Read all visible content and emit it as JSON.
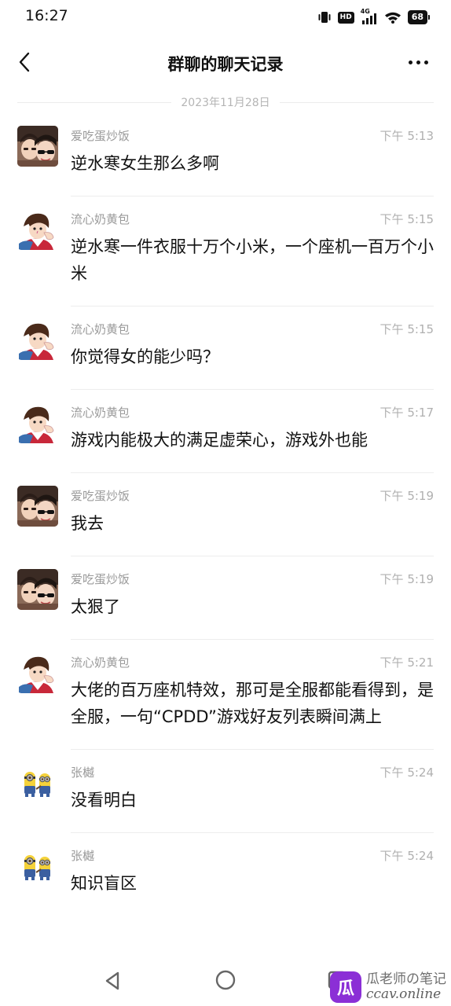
{
  "status_bar": {
    "time": "16:27",
    "hd_label": "HD",
    "network_label": "4G",
    "battery_level": "68"
  },
  "header": {
    "title": "群聊的聊天记录"
  },
  "date_divider": "2023年11月28日",
  "messages": [
    {
      "sender": "爱吃蛋炒饭",
      "time": "下午 5:13",
      "text": "逆水寒女生那么多啊",
      "avatar": "anime-couple-avatar"
    },
    {
      "sender": "流心奶黄包",
      "time": "下午 5:15",
      "text": "逆水寒一件衣服十万个小米，一个座机一百万个小米",
      "avatar": "anime-boy-avatar"
    },
    {
      "sender": "流心奶黄包",
      "time": "下午 5:15",
      "text": "你觉得女的能少吗？",
      "avatar": "anime-boy-avatar"
    },
    {
      "sender": "流心奶黄包",
      "time": "下午 5:17",
      "text": "游戏内能极大的满足虚荣心，游戏外也能",
      "avatar": "anime-boy-avatar"
    },
    {
      "sender": "爱吃蛋炒饭",
      "time": "下午 5:19",
      "text": "我去",
      "avatar": "anime-couple-avatar"
    },
    {
      "sender": "爱吃蛋炒饭",
      "time": "下午 5:19",
      "text": "太狠了",
      "avatar": "anime-couple-avatar"
    },
    {
      "sender": "流心奶黄包",
      "time": "下午 5:21",
      "text": "大佬的百万座机特效，那可是全服都能看得到，是全服，一句“CPDD”游戏好友列表瞬间满上",
      "avatar": "anime-boy-avatar"
    },
    {
      "sender": "张樾",
      "time": "下午 5:24",
      "text": "没看明白",
      "avatar": "minions-avatar"
    },
    {
      "sender": "张樾",
      "time": "下午 5:24",
      "text": "知识盲区",
      "avatar": "minions-avatar"
    }
  ],
  "watermark": {
    "logo_char": "瓜",
    "line1": "瓜老师の笔记",
    "line2": "ccav.online"
  },
  "colors": {
    "text_primary": "#111111",
    "text_secondary": "#9a9a9a",
    "divider": "#ededed",
    "watermark_brand": "#8b2fd6"
  }
}
